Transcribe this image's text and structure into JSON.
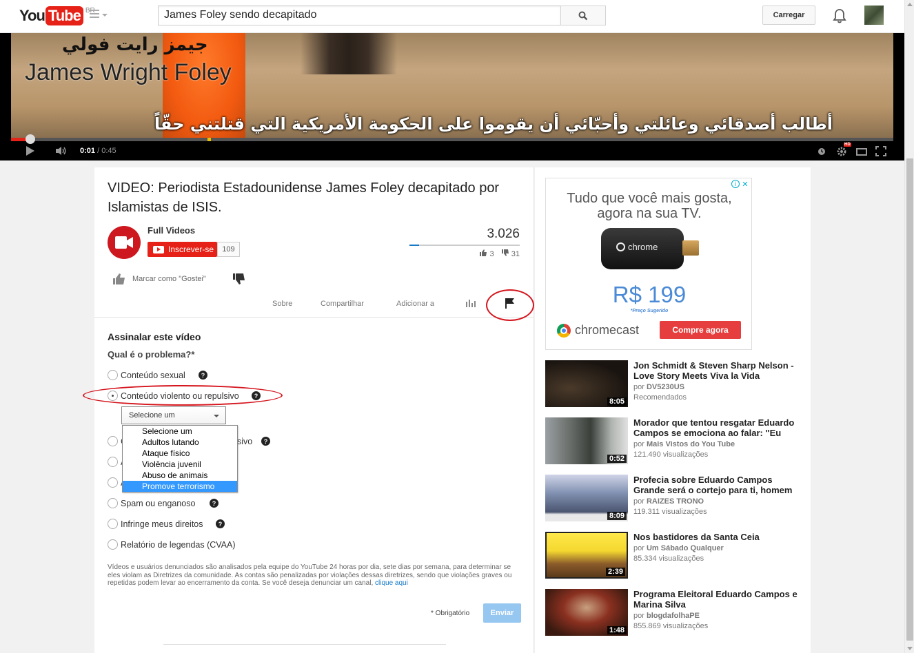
{
  "header": {
    "logo_you": "You",
    "logo_tube": "Tube",
    "logo_region": "BR",
    "search_value": "James Foley sendo decapitado",
    "upload_label": "Carregar"
  },
  "player": {
    "overlay_name_ar": "جيمز رايت فولي",
    "overlay_name_en": "James Wright Foley",
    "subtitle_ar": "أطالب أصدقائي وعائلتي وأحبّائي أن يقوموا على الحكومة الأمريكية التي قتلتني حقّاً",
    "time_current": "0:01",
    "time_total": "/ 0:45",
    "progress_fraction": 0.022,
    "hd_label": "HD"
  },
  "video": {
    "title": "VIDEO: Periodista Estadounidense James Foley decapitado por Islamistas de ISIS.",
    "channel": "Full Videos",
    "subscribe_label": "Inscrever-se",
    "subscriber_count": "109",
    "views": "3.026",
    "likes": "3",
    "dislikes": "31",
    "like_fraction": 0.088,
    "like_action_label": "Marcar como \"Gostei\""
  },
  "tabs": {
    "about": "Sobre",
    "share": "Compartilhar",
    "add_to": "Adicionar a"
  },
  "report": {
    "heading": "Assinalar este vídeo",
    "question": "Qual é o problema?*",
    "options": [
      "Conteúdo sexual",
      "Conteúdo violento ou repulsivo",
      "",
      "",
      "",
      "Spam ou enganoso",
      "Infringe meus direitos",
      "Relatório de legendas (CVAA)"
    ],
    "partial_option_tail": "sivo",
    "partial_letter_1": "C",
    "partial_letter_2": "A",
    "partial_letter_3": "A",
    "select_value": "Selecione um",
    "dropdown_items": [
      "Selecione um",
      "Adultos lutando",
      "Ataque físico",
      "Violência juvenil",
      "Abuso de animais",
      "Promove terrorismo"
    ],
    "disclaimer": "Vídeos e usuários denunciados são analisados pela equipe do YouTube 24 horas por dia, sete dias por semana, para determinar se eles violam as Diretrizes da comunidade. As contas são penalizadas por violações dessas diretrizes, sendo que violações graves ou repetidas podem levar ao encerramento da conta. Se você deseja denunciar um canal, ",
    "disclaimer_link": "clique aqui",
    "required_note": "* Obrigatório",
    "submit_label": "Enviar",
    "help_glyph": "?"
  },
  "ad": {
    "headline_1": "Tudo que você mais gosta,",
    "headline_2": "agora na sua TV.",
    "dongle_label": "chrome",
    "price": "R$ 199",
    "price_note": "*Preço Sugerido",
    "brand": "chromecast",
    "cta": "Compre agora"
  },
  "recommendations": [
    {
      "title": "Jon Schmidt & Steven Sharp Nelson - Love Story Meets Viva la Vida",
      "by": "por",
      "channel": "DV5230US",
      "extra": "Recomendados",
      "duration": "8:05"
    },
    {
      "title": "Morador que tentou resgatar Eduardo Campos se emociona ao falar: \"Eu",
      "by": "por",
      "channel": "Mais Vistos do You Tube",
      "extra": "121.490 visualizações",
      "duration": "0:52"
    },
    {
      "title": "Profecia sobre Eduardo Campos Grande será o cortejo para ti, homem",
      "by": "por",
      "channel": "RAIZES TRONO",
      "extra": "119.311 visualizações",
      "duration": "8:09"
    },
    {
      "title": "Nos bastidores da Santa Ceia",
      "by": "por",
      "channel": "Um Sábado Qualquer",
      "extra": "85.334 visualizações",
      "duration": "2:39"
    },
    {
      "title": "Programa Eleitoral Eduardo Campos e Marina Silva",
      "by": "por",
      "channel": "blogdafolhaPE",
      "extra": "855.869 visualizações",
      "duration": "1:48"
    }
  ]
}
